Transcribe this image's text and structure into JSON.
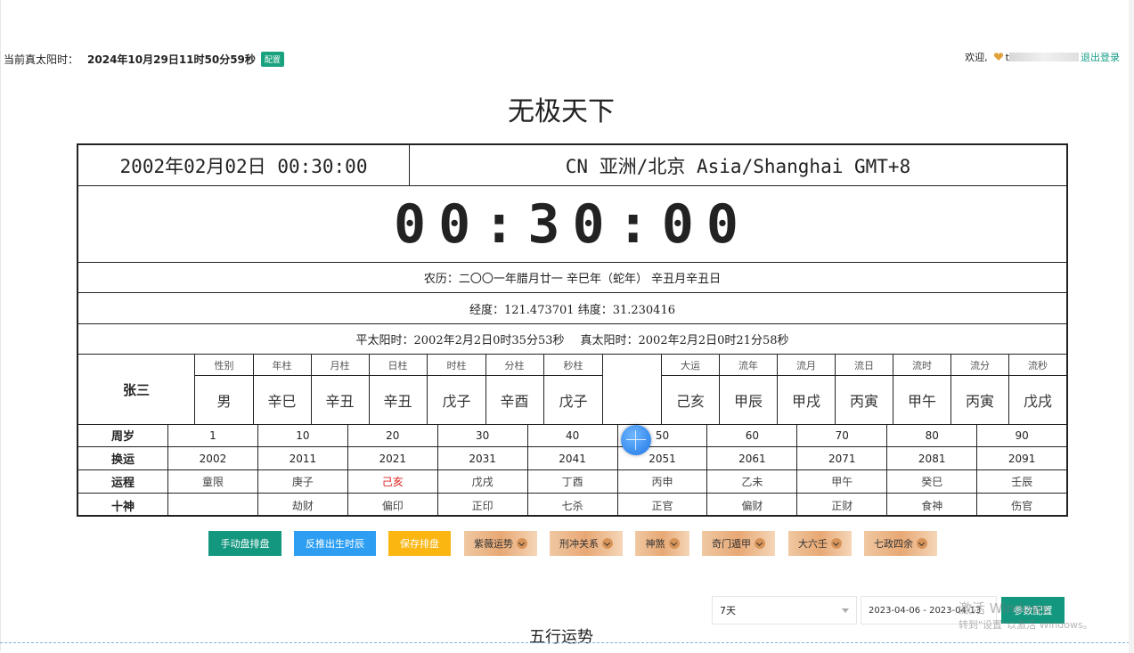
{
  "header": {
    "solar_time_label": "当前真太阳时：",
    "solar_time_value": "2024年10月29日11时50分59秒",
    "config_badge": "配置",
    "welcome": "欢迎,",
    "user_prefix": "t",
    "logout": "退出登录",
    "site_title": "无极天下"
  },
  "board": {
    "date": "2002年02月02日 00:30:00",
    "zone": "CN 亚洲/北京 Asia/Shanghai GMT+8",
    "clock": "00:30:00",
    "lunar": "农历：二〇〇一年腊月廿一 辛巳年（蛇年） 辛丑月辛丑日",
    "coords": "经度：121.473701 纬度：31.230416",
    "mean_solar": "平太阳时：2002年2月2日0时35分53秒",
    "true_solar": "真太阳时：2002年2月2日0时21分58秒",
    "name": "张三",
    "natal": [
      {
        "header": "性别",
        "value": "男"
      },
      {
        "header": "年柱",
        "value": "辛巳"
      },
      {
        "header": "月柱",
        "value": "辛丑"
      },
      {
        "header": "日柱",
        "value": "辛丑"
      },
      {
        "header": "时柱",
        "value": "戊子"
      },
      {
        "header": "分柱",
        "value": "辛酉"
      },
      {
        "header": "秒柱",
        "value": "戊子"
      }
    ],
    "flow": [
      {
        "header": "大运",
        "value": "己亥"
      },
      {
        "header": "流年",
        "value": "甲辰"
      },
      {
        "header": "流月",
        "value": "甲戌"
      },
      {
        "header": "流日",
        "value": "丙寅"
      },
      {
        "header": "流时",
        "value": "甲午"
      },
      {
        "header": "流分",
        "value": "丙寅"
      },
      {
        "header": "流秒",
        "value": "戊戌"
      }
    ],
    "fortune_rows": [
      {
        "label": "周岁",
        "cells": [
          "1",
          "10",
          "20",
          "30",
          "40",
          "50",
          "60",
          "70",
          "80",
          "90"
        ]
      },
      {
        "label": "换运",
        "cells": [
          "2002",
          "2011",
          "2021",
          "2031",
          "2041",
          "2051",
          "2061",
          "2071",
          "2081",
          "2091"
        ]
      },
      {
        "label": "运程",
        "cells": [
          "童限",
          "庚子",
          "己亥",
          "戊戌",
          "丁酉",
          "丙申",
          "乙未",
          "甲午",
          "癸巳",
          "壬辰"
        ]
      },
      {
        "label": "十神",
        "cells": [
          "",
          "劫财",
          "偏印",
          "正印",
          "七杀",
          "正官",
          "偏财",
          "正财",
          "食神",
          "伤官"
        ]
      }
    ],
    "highlight_color": "#e02020"
  },
  "buttons": {
    "manual": "手动盘排盘",
    "reverse": "反推出生时辰",
    "save": "保存排盘",
    "ziwei": "紫薇运势",
    "xingchong": "刑冲关系",
    "shensha": "神煞",
    "qimen": "奇门遁甲",
    "liuren": "大六壬",
    "qizheng": "七政四余"
  },
  "controls": {
    "range_select": "7天",
    "date_range": "2023-04-06 - 2023-04-13",
    "param_button": "参数配置"
  },
  "watermark": {
    "line1": "激活 Windows",
    "line2": "转到\"设置\"以激活 Windows。"
  },
  "section": {
    "title": "五行运势"
  },
  "colors": {
    "teal": "#13977f",
    "blue": "#2d9ef2",
    "yellow": "#fbb612"
  }
}
